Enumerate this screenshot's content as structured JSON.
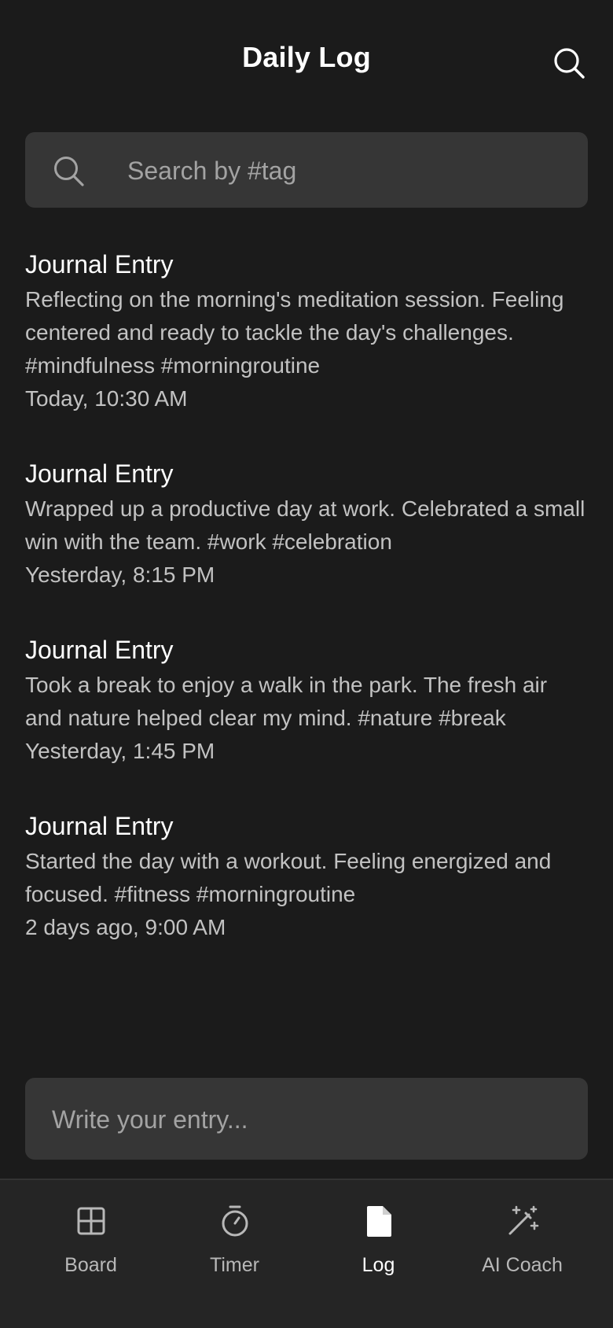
{
  "header": {
    "title": "Daily Log",
    "search_icon": "search-icon"
  },
  "search": {
    "placeholder": "Search by #tag",
    "value": "",
    "icon": "search-icon"
  },
  "entries": [
    {
      "title": "Journal Entry",
      "body": "Reflecting on the morning's meditation session. Feeling centered and ready to tackle the day's challenges. #mindfulness #morningroutine",
      "time": "Today, 10:30 AM"
    },
    {
      "title": "Journal Entry",
      "body": "Wrapped up a productive day at work. Celebrated a small win with the team. #work #celebration",
      "time": "Yesterday, 8:15 PM"
    },
    {
      "title": "Journal Entry",
      "body": "Took a break to enjoy a walk in the park. The fresh air and nature helped clear my mind. #nature #break",
      "time": "Yesterday, 1:45 PM"
    },
    {
      "title": "Journal Entry",
      "body": "Started the day with a workout. Feeling energized and focused. #fitness #morningroutine",
      "time": "2 days ago, 9:00 AM"
    }
  ],
  "composer": {
    "placeholder": "Write your entry...",
    "value": ""
  },
  "tabs": [
    {
      "label": "Board",
      "icon": "grid-icon",
      "active": false
    },
    {
      "label": "Timer",
      "icon": "stopwatch-icon",
      "active": false
    },
    {
      "label": "Log",
      "icon": "document-icon",
      "active": true
    },
    {
      "label": "AI Coach",
      "icon": "magic-wand-icon",
      "active": false
    }
  ],
  "colors": {
    "background": "#1b1b1b",
    "surface": "#363636",
    "tabbar": "#252525",
    "text_primary": "#ffffff",
    "text_secondary": "#c2c2c2",
    "tab_inactive": "#b8b8b8"
  }
}
